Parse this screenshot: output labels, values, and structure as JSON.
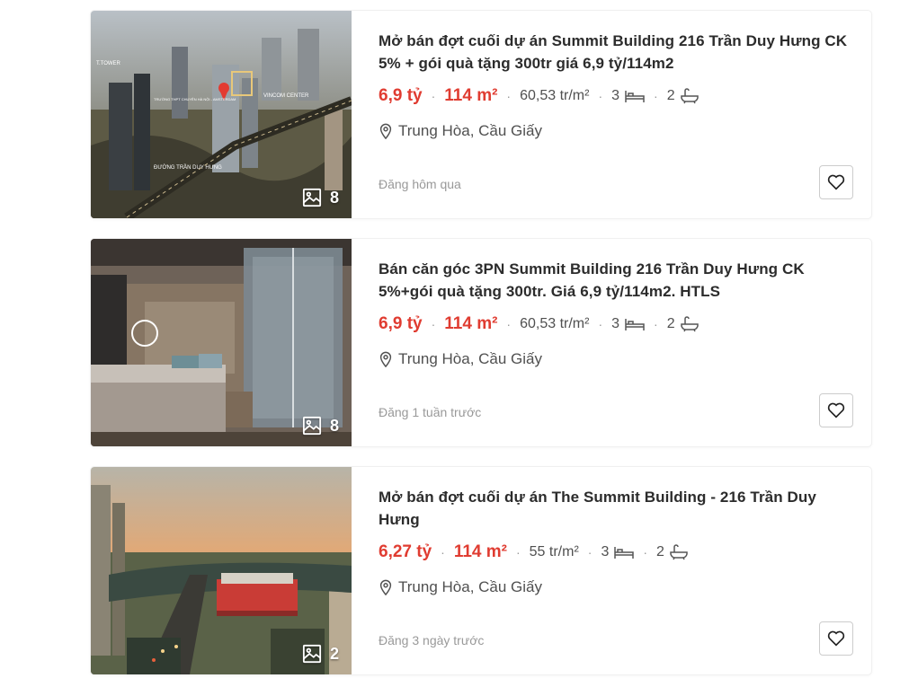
{
  "listings": [
    {
      "title": "Mở bán đợt cuối dự án Summit Building 216 Trần Duy Hưng CK 5% + gói quà tặng 300tr giá 6,9 tỷ/114m2",
      "price": "6,9 tỷ",
      "area": "114 m²",
      "price_per_m2": "60,53 tr/m²",
      "bedrooms": "3",
      "bathrooms": "2",
      "location": "Trung Hòa, Cầu Giấy",
      "posted": "Đăng hôm qua",
      "photo_count": "8",
      "image_labels": {
        "tower": "T.TOWER",
        "school": "TRƯỜNG THPT CHUYÊN HÀ NỘI - AMSTERDAM",
        "vincom": "VINCOM CENTER",
        "road": "ĐƯỜNG TRẦN DUY HƯNG"
      }
    },
    {
      "title": "Bán căn góc 3PN Summit Building 216 Trần Duy Hưng CK 5%+gói quà tặng 300tr. Giá 6,9 tỷ/114m2. HTLS",
      "price": "6,9 tỷ",
      "area": "114 m²",
      "price_per_m2": "60,53 tr/m²",
      "bedrooms": "3",
      "bathrooms": "2",
      "location": "Trung Hòa, Cầu Giấy",
      "posted": "Đăng 1 tuần trước",
      "photo_count": "8"
    },
    {
      "title": "Mở bán đợt cuối dự án The Summit Building - 216 Trần Duy Hưng",
      "price": "6,27 tỷ",
      "area": "114 m²",
      "price_per_m2": "55 tr/m²",
      "bedrooms": "3",
      "bathrooms": "2",
      "location": "Trung Hòa, Cầu Giấy",
      "posted": "Đăng 3 ngày trước",
      "photo_count": "2"
    }
  ],
  "colors": {
    "price": "#e03c31",
    "muted": "#999999",
    "text": "#2c2c2c"
  },
  "icons": {
    "photos": "image-icon",
    "bed": "bed-icon",
    "bath": "bathtub-icon",
    "location": "map-pin-icon",
    "favorite": "heart-icon"
  }
}
